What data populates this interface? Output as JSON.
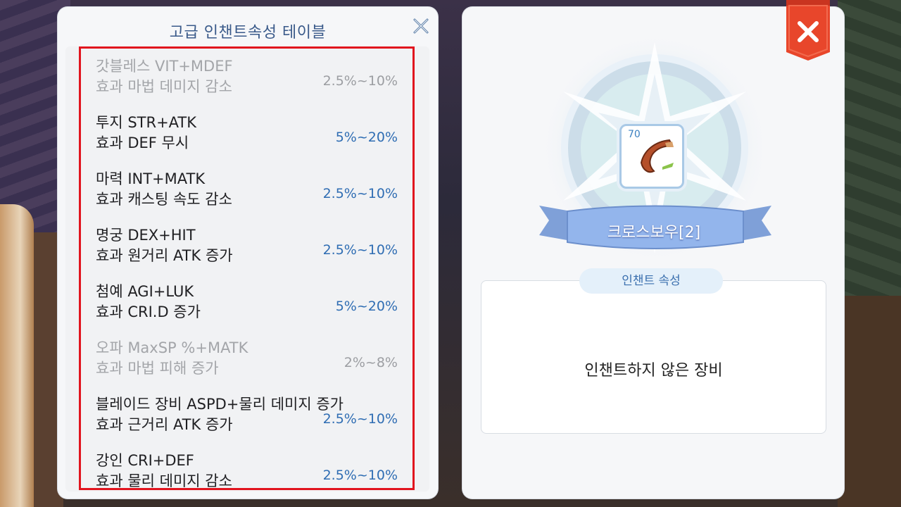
{
  "left_panel": {
    "title": "고급 인챈트속성 테이블",
    "close_icon": "close-x-icon",
    "rows": [
      {
        "name": "갓블레스 VIT+MDEF",
        "effect": "효과 마법 데미지 감소",
        "range": "2.5%~10%",
        "dimmed": true
      },
      {
        "name": "투지 STR+ATK",
        "effect": "효과 DEF 무시",
        "range": "5%~20%",
        "dimmed": false
      },
      {
        "name": "마력 INT+MATK",
        "effect": "효과 캐스팅 속도 감소",
        "range": "2.5%~10%",
        "dimmed": false
      },
      {
        "name": "명궁 DEX+HIT",
        "effect": "효과 원거리 ATK 증가",
        "range": "2.5%~10%",
        "dimmed": false
      },
      {
        "name": "첨예 AGI+LUK",
        "effect": "효과 CRI.D 증가",
        "range": "5%~20%",
        "dimmed": false
      },
      {
        "name": "오파 MaxSP %+MATK",
        "effect": "효과 마법 피해 증가",
        "range": "2%~8%",
        "dimmed": true
      },
      {
        "name": "블레이드 장비 ASPD+물리 데미지 증가",
        "effect": "효과 근거리 ATK 증가",
        "range": "2.5%~10%",
        "dimmed": false
      },
      {
        "name": "강인 CRI+DEF",
        "effect": "효과 물리 데미지 감소",
        "range": "2.5%~10%",
        "dimmed": false
      }
    ]
  },
  "right_panel": {
    "item": {
      "level": "70",
      "name": "크로스보우[2]",
      "icon": "crossbow-icon"
    },
    "tab_label": "인챈트 속성",
    "status_text": "인챈트하지 않은 장비",
    "close_icon": "close-icon"
  },
  "colors": {
    "title": "#3a5a8a",
    "range_active": "#2f6db3",
    "range_dim": "#9c9ea2",
    "highlight_border": "#e1141e",
    "close_button": "#e8462b"
  }
}
